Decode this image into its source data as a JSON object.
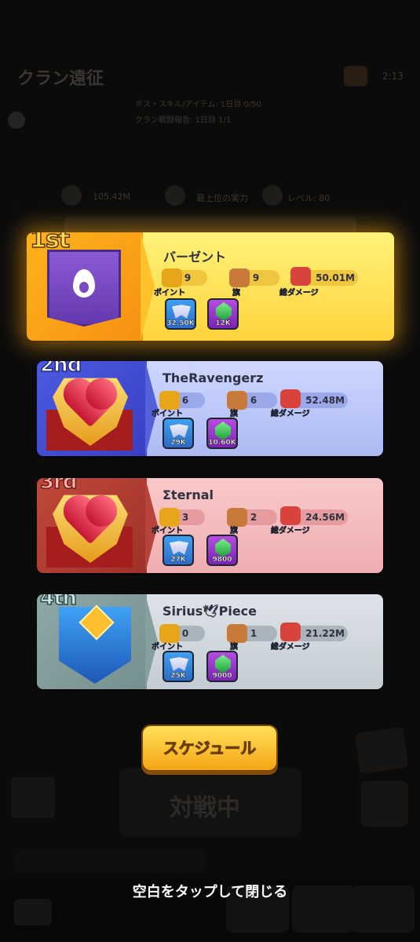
{
  "background": {
    "title": "クラン遠征",
    "timer": "2:13",
    "sub_lines": [
      "ボス・スキル/アイテム: 1日目 0/50",
      "クラン戦闘報告: 1日目 1/1"
    ],
    "stats": [
      "105.42M",
      "最上位の実力",
      "レベル: 80"
    ],
    "fight_label": "対戦中"
  },
  "ranking": [
    {
      "position": "1st",
      "name": "バーゼント",
      "points": "9",
      "flags": "9",
      "damage": "50.01M",
      "reward_wings": "32.50K",
      "reward_gems": "12K",
      "emblem": "flame-banner-icon"
    },
    {
      "position": "2nd",
      "name": "TheRavengerz",
      "points": "6",
      "flags": "6",
      "damage": "52.48M",
      "reward_wings": "29K",
      "reward_gems": "10.60K",
      "emblem": "heart-shield-icon"
    },
    {
      "position": "3rd",
      "name": "Σternal",
      "points": "3",
      "flags": "2",
      "damage": "24.56M",
      "reward_wings": "27K",
      "reward_gems": "9800",
      "emblem": "heart-shield-icon"
    },
    {
      "position": "4th",
      "name": "Sirius🕊Piece",
      "points": "0",
      "flags": "1",
      "damage": "21.22M",
      "reward_wings": "25K",
      "reward_gems": "9000",
      "emblem": "blue-shield-icon"
    }
  ],
  "labels": {
    "points": "ポイント",
    "flags": "旗",
    "damage": "総ダメージ"
  },
  "schedule_button": "スケジュール",
  "close_hint": "空白をタップして閉じる",
  "colors": {
    "gold": "#ffd84a",
    "blue": "#b7c2f5",
    "red": "#f2b5b8",
    "gray": "#c9d0d6"
  }
}
